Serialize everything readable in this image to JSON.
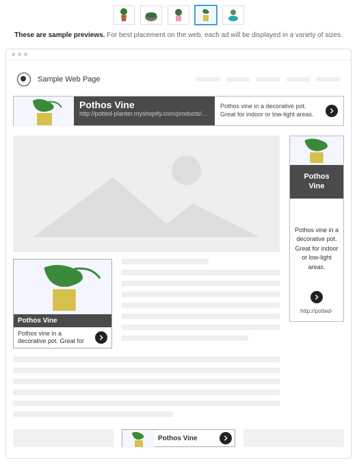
{
  "thumbnails": [
    {
      "name": "pothos-pot",
      "selected": false
    },
    {
      "name": "terrarium-bowl",
      "selected": false
    },
    {
      "name": "pink-plant",
      "selected": false
    },
    {
      "name": "pothos-vine",
      "selected": true
    },
    {
      "name": "succulent-teal",
      "selected": false
    }
  ],
  "note": {
    "strong": "These are sample previews.",
    "rest": " For best placement on the web, each ad will be displayed in a variety of sizes."
  },
  "page": {
    "title": "Sample Web Page"
  },
  "ad": {
    "title": "Pothos Vine",
    "url_long": "http://potted-planter.myshopify.com/products/pot",
    "url_short": "http://potted-",
    "desc": "Pothos vine in a decorative pot. Great for indoor or low-light areas."
  }
}
